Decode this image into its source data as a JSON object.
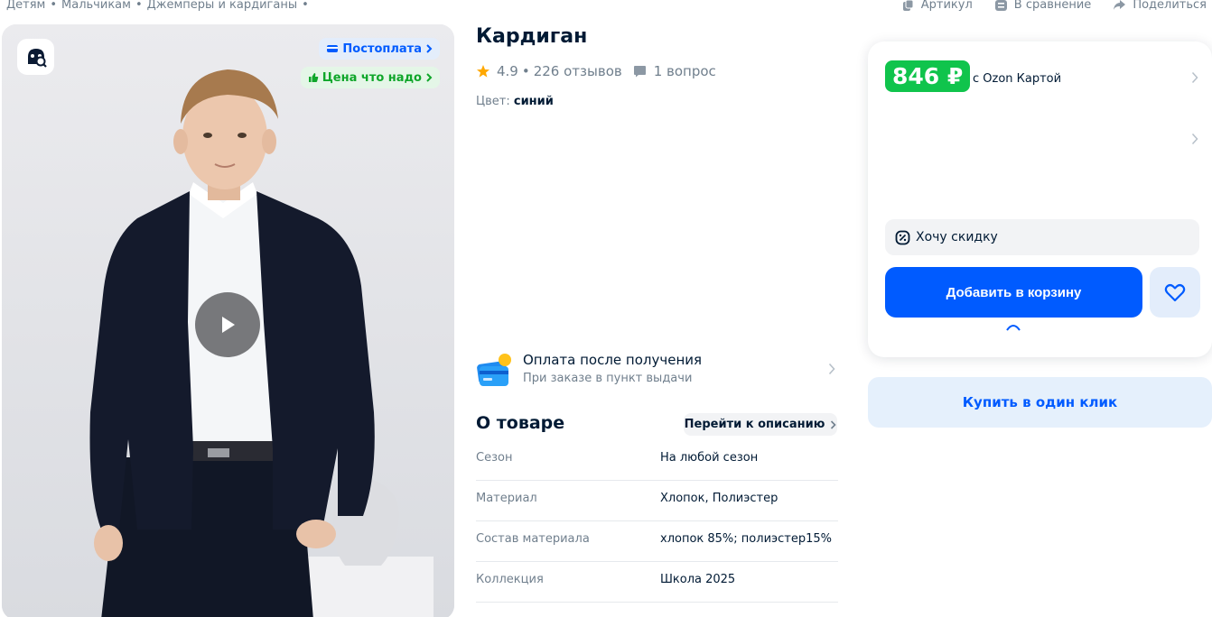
{
  "breadcrumbs": [
    "Детям",
    "Мальчикам",
    "Джемперы и кардиганы"
  ],
  "breadcrumb_separator": "•",
  "top_actions": {
    "article_label": "Артикул",
    "compare_label": "В сравнение",
    "share_label": "Поделиться"
  },
  "gallery": {
    "badge_postpay": "Постоплата",
    "badge_price": "Цена что надо",
    "icons": [
      "search-lens-icon",
      "play-icon"
    ]
  },
  "product": {
    "title": "Кардиган",
    "rating": "4.9",
    "rating_separator": "•",
    "reviews": "226 отзывов",
    "questions": "1 вопрос",
    "color_label": "Цвет:",
    "color_value": "синий"
  },
  "payment": {
    "title": "Оплата после получения",
    "subtitle": "При заказе в пункт выдачи"
  },
  "about": {
    "title": "О товаре",
    "link_label": "Перейти к описанию",
    "specs": [
      {
        "key": "Сезон",
        "value": "На любой сезон"
      },
      {
        "key": "Материал",
        "value": "Хлопок, Полиэстер"
      },
      {
        "key": "Состав материала",
        "value": "хлопок 85%; полиэстер15%"
      },
      {
        "key": "Коллекция",
        "value": "Школа 2025"
      }
    ]
  },
  "buy": {
    "price": "846 ₽",
    "price_note": "с Ozon Картой",
    "discount_label": "Хочу скидку",
    "add_to_cart": "Добавить в корзину",
    "one_click": "Купить в один клик"
  },
  "colors": {
    "accent_blue": "#005bff",
    "price_green": "#10c44c",
    "badge_green_text": "#0fa62a",
    "muted_text": "#707f8d"
  }
}
